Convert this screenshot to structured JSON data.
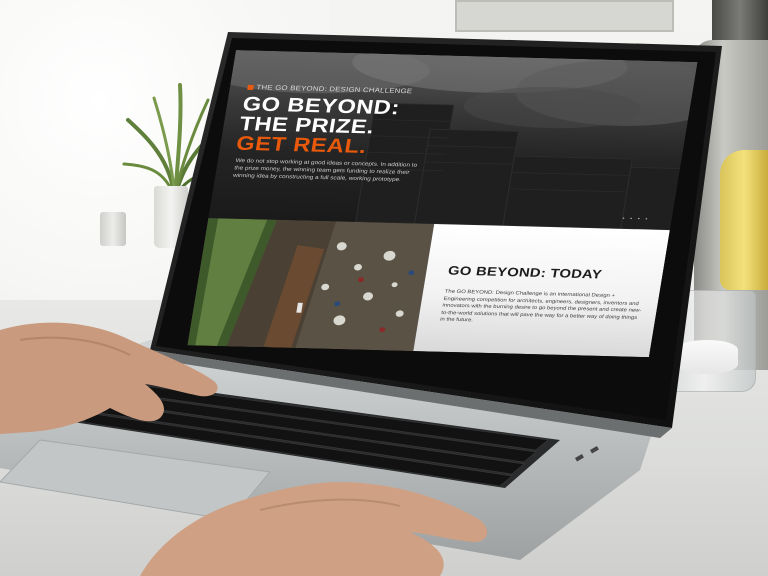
{
  "hero": {
    "eyebrow": "THE GO BEYOND: DESIGN CHALLENGE",
    "headline_line1": "GO BEYOND:",
    "headline_line2": "THE PRIZE.",
    "headline_line3": "GET REAL.",
    "body": "We do not stop working at good ideas or concepts. In addition to the prize money, the winning team gets funding to realize their winning idea by constructing a full scale, working prototype.",
    "dots": "• • • •"
  },
  "today": {
    "title": "GO BEYOND: TODAY",
    "body": "The GO BEYOND: Design Challenge is an international Design + Engineering competition for architects, engineers, designers, inventors and innovators with the burning desire to go beyond the present and create new-to-the-world solutions that will pave the way for a better way of doing things in the future."
  },
  "colors": {
    "accent_orange": "#e8590c",
    "hero_bg": "#1a1a1a",
    "today_bg": "#ffffff"
  }
}
